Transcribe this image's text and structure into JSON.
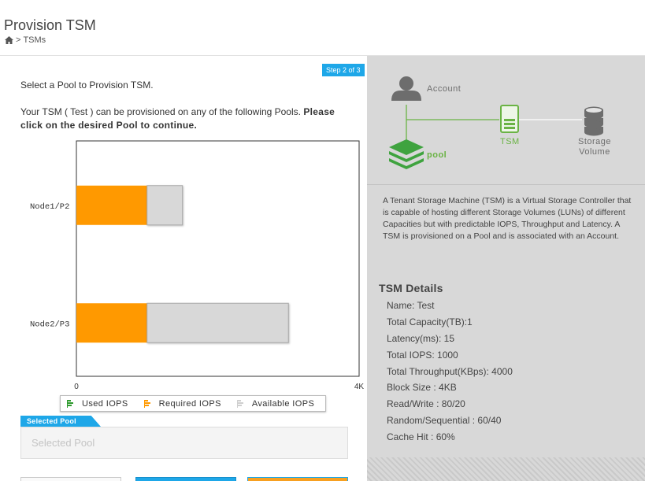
{
  "header": {
    "title": "Provision TSM",
    "breadcrumb": {
      "separator": ">",
      "current": "TSMs"
    }
  },
  "wizard": {
    "step_badge": "Step 2 of 3",
    "intro": "Select a Pool to Provision TSM.",
    "pools_text_prefix": "Your TSM ( Test ) can be provisioned on any of the following Pools.",
    "pools_text_bold": "Please click on the desired Pool to continue."
  },
  "chart_data": {
    "type": "bar",
    "orientation": "horizontal",
    "stacked": true,
    "categories": [
      "Node1/P2",
      "Node2/P3"
    ],
    "series": [
      {
        "name": "Used IOPS",
        "color": "#2e9a2e",
        "values": [
          0,
          0
        ]
      },
      {
        "name": "Required IOPS",
        "color": "#ff9900",
        "values": [
          1000,
          1000
        ]
      },
      {
        "name": "Available IOPS",
        "color": "#d8d8d8",
        "values": [
          500,
          2000
        ]
      }
    ],
    "xlim": [
      0,
      4000
    ],
    "x_tick_labels": [
      "0",
      "4K"
    ],
    "legend": "bottom"
  },
  "selected_pool": {
    "tab_label": "Selected Pool",
    "placeholder": "Selected Pool",
    "value": ""
  },
  "diagram": {
    "account_label": "Account",
    "pool_label": "pool",
    "tsm_label": "TSM",
    "storage_label_line1": "Storage",
    "storage_label_line2": "Volume",
    "accent": "#6ab344",
    "muted": "#6d6d6d"
  },
  "about": "A Tenant Storage Machine (TSM) is a Virtual Storage Controller that is capable of hosting different Storage Volumes (LUNs) of different Capacities but with predictable IOPS, Throughput and Latency. A TSM is provisioned on a Pool and is associated with an Account.",
  "tsm_details": {
    "title": "TSM Details",
    "items": [
      "Name: Test",
      "Total Capacity(TB):1",
      "Latency(ms): 15",
      "Total IOPS: 1000",
      "Total Throughput(KBps): 4000",
      "Block Size : 4KB",
      "Read/Write : 80/20",
      "Random/Sequential : 60/40",
      "Cache Hit : 60%"
    ]
  }
}
